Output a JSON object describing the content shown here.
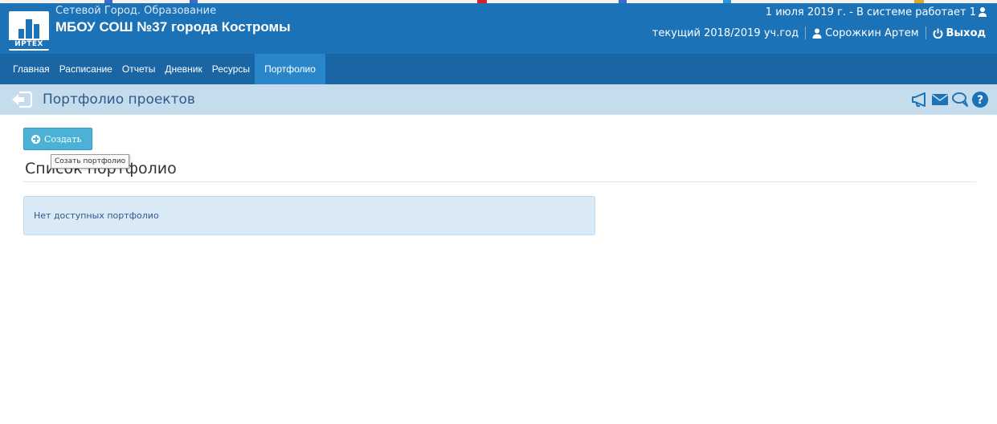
{
  "header": {
    "app_name": "Сетевой Город. Образование",
    "school_name": "МБОУ СОШ №37 города Костромы",
    "logo_text": "ИРТЕХ",
    "date_status": "1 июля 2019 г. - В системе работает 1",
    "academic_year": "текущий 2018/2019 уч.год",
    "user_name": "Сорожкин Артем",
    "logout_label": "Выход",
    "icons": [
      "logo-icon",
      "users-online-icon",
      "user-icon",
      "power-icon"
    ]
  },
  "nav": {
    "items": [
      {
        "label": "Главная"
      },
      {
        "label": "Расписание"
      },
      {
        "label": "Отчеты"
      },
      {
        "label": "Дневник"
      },
      {
        "label": "Ресурсы"
      },
      {
        "label": "Портфолио",
        "active": true
      }
    ]
  },
  "titlebar": {
    "title": "Портфолио проектов",
    "icons": [
      "back-icon",
      "megaphone-icon",
      "envelope-icon",
      "chat-icon",
      "help-icon"
    ]
  },
  "main": {
    "create_button": "Создать",
    "tooltip": "Созать портфолио",
    "section_title": "Список портфолио",
    "empty_message": "Нет доступных портфолио"
  },
  "colors": {
    "header_bg": "#1b72b7",
    "nav_bg": "#1a65a3",
    "nav_active": "#2a86cb",
    "titlebar_bg": "#c5dced",
    "button_bg": "#4cb1d6",
    "alert_bg": "#d9eaf6",
    "alert_text": "#31588a"
  }
}
